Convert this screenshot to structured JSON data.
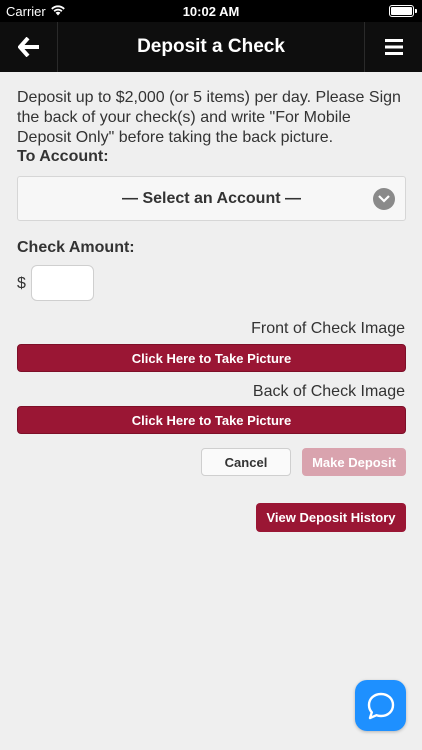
{
  "status_bar": {
    "carrier": "Carrier",
    "time": "10:02 AM",
    "battery_level": 1.0
  },
  "nav": {
    "title": "Deposit a Check",
    "back_icon": "back-arrow-icon",
    "menu_icon": "hamburger-menu-icon"
  },
  "form": {
    "intro_text": "Deposit up to $2,000 (or 5 items) per day. Please Sign the back of your check(s) and write \"For Mobile Deposit Only\" before taking the back picture.",
    "to_account_label": "To Account:",
    "account_select_value": "— Select an Account —",
    "check_amount_label": "Check Amount:",
    "currency_symbol": "$",
    "amount_value": "",
    "front_label": "Front of Check Image",
    "front_button": "Click Here to Take Picture",
    "back_label": "Back of Check Image",
    "back_button": "Click Here to Take Picture",
    "cancel_button": "Cancel",
    "make_deposit_button": "Make Deposit",
    "view_history_button": "View Deposit History"
  },
  "chat_icon": "chat-bubble-icon",
  "colors": {
    "brand": "#9a1634",
    "disabled": "#d9a3ae",
    "chat": "#1e90ff",
    "nav_bg": "#0e0e0e"
  }
}
